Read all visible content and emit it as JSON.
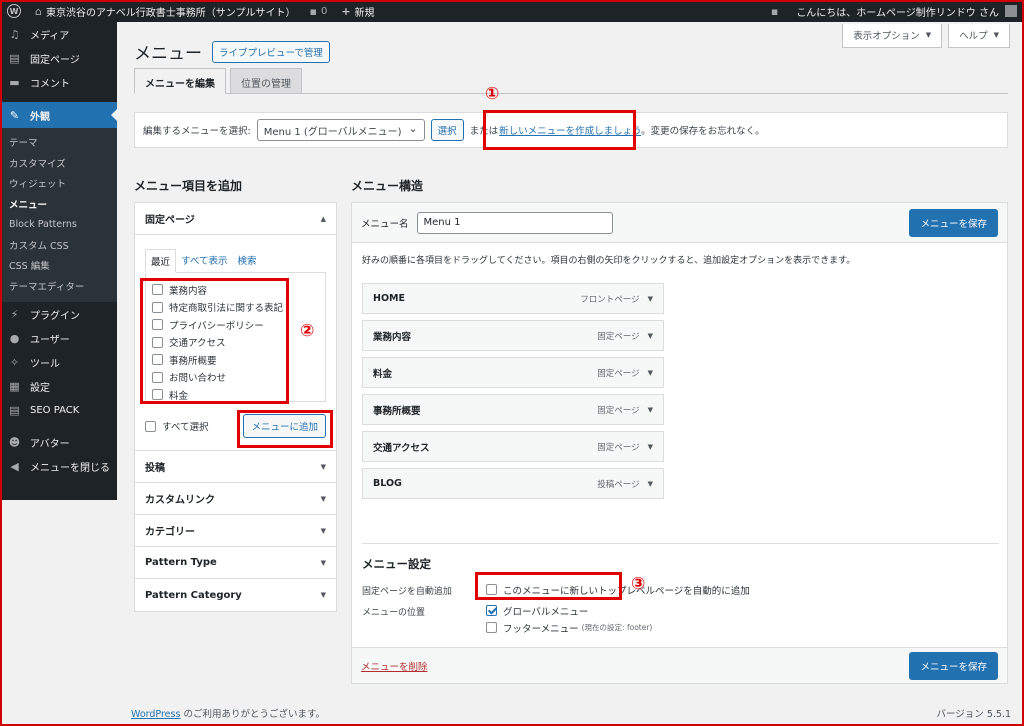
{
  "adminbar": {
    "site_name": "東京渋谷のアナベル行政書士事務所（サンプルサイト）",
    "comments_count": "0",
    "new_label": "新規",
    "greeting": "こんにちは、ホームページ制作リンドウ さん"
  },
  "sidebar": {
    "items": [
      {
        "label": "メディア"
      },
      {
        "label": "固定ページ"
      },
      {
        "label": "コメント"
      },
      {
        "label": "外観"
      },
      {
        "label": "プラグイン"
      },
      {
        "label": "ユーザー"
      },
      {
        "label": "ツール"
      },
      {
        "label": "設定"
      },
      {
        "label": "SEO PACK"
      },
      {
        "label": "アバター"
      },
      {
        "label": "メニューを閉じる"
      }
    ],
    "submenu": [
      "テーマ",
      "カスタマイズ",
      "ウィジェット",
      "メニュー",
      "Block Patterns",
      "カスタム CSS",
      "CSS 編集",
      "テーマエディター"
    ]
  },
  "screen_options": "表示オプション",
  "help": "ヘルプ",
  "page": {
    "title": "メニュー",
    "live_preview": "ライブプレビューで管理"
  },
  "tabs": [
    "メニューを編集",
    "位置の管理"
  ],
  "select_bar": {
    "label": "編集するメニューを選択:",
    "selected": "Menu 1 (グローバルメニュー)",
    "select_btn": "選択",
    "or": "または",
    "create_link": "新しいメニューを作成しましょう",
    "tail": "。変更の保存をお忘れなく。"
  },
  "add_items": {
    "title": "メニュー項目を追加",
    "pages_head": "固定ページ",
    "inner_tabs": [
      "最近",
      "すべて表示",
      "検索"
    ],
    "pages": [
      "業務内容",
      "特定商取引法に関する表記",
      "プライバシーポリシー",
      "交通アクセス",
      "事務所概要",
      "お問い合わせ",
      "料金"
    ],
    "select_all": "すべて選択",
    "add_btn": "メニューに追加",
    "sections": [
      "投稿",
      "カスタムリンク",
      "カテゴリー",
      "Pattern Type",
      "Pattern Category"
    ]
  },
  "structure": {
    "title": "メニュー構造",
    "name_label": "メニュー名",
    "name_value": "Menu 1",
    "save_btn": "メニューを保存",
    "hint": "好みの順番に各項目をドラッグしてください。項目の右側の矢印をクリックすると、追加設定オプションを表示できます。",
    "items": [
      {
        "label": "HOME",
        "type": "フロントページ"
      },
      {
        "label": "業務内容",
        "type": "固定ページ"
      },
      {
        "label": "料金",
        "type": "固定ページ"
      },
      {
        "label": "事務所概要",
        "type": "固定ページ"
      },
      {
        "label": "交通アクセス",
        "type": "固定ページ"
      },
      {
        "label": "BLOG",
        "type": "投稿ページ"
      }
    ],
    "settings_title": "メニュー設定",
    "auto_add_label": "固定ページを自動追加",
    "auto_add_opt": "このメニューに新しいトップレベルページを自動的に追加",
    "location_label": "メニューの位置",
    "loc_global": "グローバルメニュー",
    "loc_footer": "フッターメニュー",
    "loc_footer_note": "(現在の設定: footer)",
    "delete_link": "メニューを削除"
  },
  "markers": [
    "①",
    "②",
    "③"
  ],
  "footer": {
    "wp_link": "WordPress",
    "thanks": "のご利用ありがとうございます。",
    "version": "バージョン 5.5.1"
  }
}
